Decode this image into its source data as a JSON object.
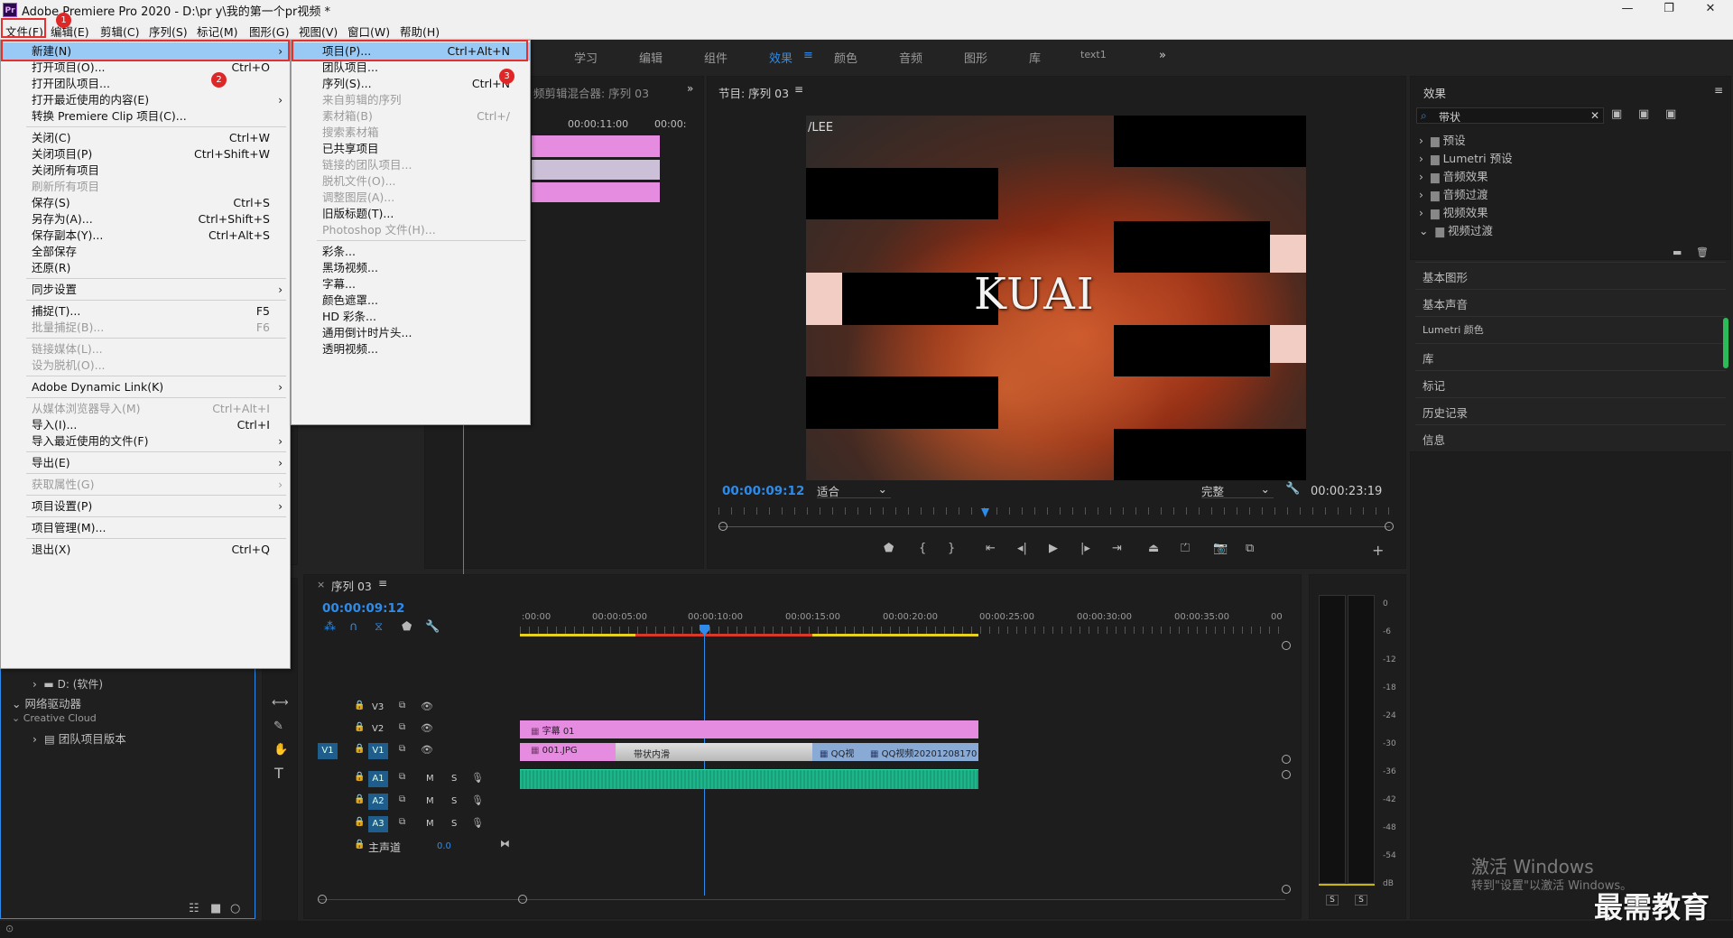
{
  "window": {
    "title": "Adobe Premiere Pro 2020 - D:\\pr y\\我的第一个pr视频 *",
    "app_icon": "Pr"
  },
  "menubar": [
    "文件(F)",
    "编辑(E)",
    "剪辑(C)",
    "序列(S)",
    "标记(M)",
    "图形(G)",
    "视图(V)",
    "窗口(W)",
    "帮助(H)"
  ],
  "workspaces": [
    {
      "label": "学习",
      "active": false
    },
    {
      "label": "编辑",
      "active": false
    },
    {
      "label": "组件",
      "active": false
    },
    {
      "label": "效果",
      "active": true
    },
    {
      "label": "颜色",
      "active": false
    },
    {
      "label": "音频",
      "active": false
    },
    {
      "label": "图形",
      "active": false
    },
    {
      "label": "库",
      "active": false
    },
    {
      "label": "text1",
      "active": false
    }
  ],
  "badges": [
    "1",
    "2",
    "3"
  ],
  "file_menu": [
    {
      "label": "新建(N)",
      "shortcut": "",
      "submenu": true,
      "disabled": false,
      "highlight": true
    },
    {
      "label": "打开项目(O)...",
      "shortcut": "Ctrl+O",
      "submenu": false,
      "disabled": false
    },
    {
      "label": "打开团队项目...",
      "shortcut": "",
      "submenu": false,
      "disabled": false
    },
    {
      "label": "打开最近使用的内容(E)",
      "shortcut": "",
      "submenu": true,
      "disabled": false
    },
    {
      "label": "转换 Premiere Clip 项目(C)...",
      "shortcut": "",
      "submenu": false,
      "disabled": false
    },
    {
      "sep": true
    },
    {
      "label": "关闭(C)",
      "shortcut": "Ctrl+W",
      "submenu": false,
      "disabled": false
    },
    {
      "label": "关闭项目(P)",
      "shortcut": "Ctrl+Shift+W",
      "submenu": false,
      "disabled": false
    },
    {
      "label": "关闭所有项目",
      "shortcut": "",
      "submenu": false,
      "disabled": false
    },
    {
      "label": "刷新所有项目",
      "shortcut": "",
      "submenu": false,
      "disabled": true
    },
    {
      "label": "保存(S)",
      "shortcut": "Ctrl+S",
      "submenu": false,
      "disabled": false
    },
    {
      "label": "另存为(A)...",
      "shortcut": "Ctrl+Shift+S",
      "submenu": false,
      "disabled": false
    },
    {
      "label": "保存副本(Y)...",
      "shortcut": "Ctrl+Alt+S",
      "submenu": false,
      "disabled": false
    },
    {
      "label": "全部保存",
      "shortcut": "",
      "submenu": false,
      "disabled": false
    },
    {
      "label": "还原(R)",
      "shortcut": "",
      "submenu": false,
      "disabled": false
    },
    {
      "sep": true
    },
    {
      "label": "同步设置",
      "shortcut": "",
      "submenu": true,
      "disabled": false
    },
    {
      "sep": true
    },
    {
      "label": "捕捉(T)...",
      "shortcut": "F5",
      "submenu": false,
      "disabled": false
    },
    {
      "label": "批量捕捉(B)...",
      "shortcut": "F6",
      "submenu": false,
      "disabled": true
    },
    {
      "sep": true
    },
    {
      "label": "链接媒体(L)...",
      "shortcut": "",
      "submenu": false,
      "disabled": true
    },
    {
      "label": "设为脱机(O)...",
      "shortcut": "",
      "submenu": false,
      "disabled": true
    },
    {
      "sep": true
    },
    {
      "label": "Adobe Dynamic Link(K)",
      "shortcut": "",
      "submenu": true,
      "disabled": false
    },
    {
      "sep": true
    },
    {
      "label": "从媒体浏览器导入(M)",
      "shortcut": "Ctrl+Alt+I",
      "submenu": false,
      "disabled": true
    },
    {
      "label": "导入(I)...",
      "shortcut": "Ctrl+I",
      "submenu": false,
      "disabled": false
    },
    {
      "label": "导入最近使用的文件(F)",
      "shortcut": "",
      "submenu": true,
      "disabled": false
    },
    {
      "sep": true
    },
    {
      "label": "导出(E)",
      "shortcut": "",
      "submenu": true,
      "disabled": false
    },
    {
      "sep": true
    },
    {
      "label": "获取属性(G)",
      "shortcut": "",
      "submenu": true,
      "disabled": true
    },
    {
      "sep": true
    },
    {
      "label": "项目设置(P)",
      "shortcut": "",
      "submenu": true,
      "disabled": false
    },
    {
      "sep": true
    },
    {
      "label": "项目管理(M)...",
      "shortcut": "",
      "submenu": false,
      "disabled": false
    },
    {
      "sep": true
    },
    {
      "label": "退出(X)",
      "shortcut": "Ctrl+Q",
      "submenu": false,
      "disabled": false
    }
  ],
  "new_submenu": [
    {
      "label": "项目(P)...",
      "shortcut": "Ctrl+Alt+N",
      "disabled": false,
      "highlight": true
    },
    {
      "label": "团队项目...",
      "shortcut": "",
      "disabled": false
    },
    {
      "label": "序列(S)...",
      "shortcut": "Ctrl+N",
      "disabled": false
    },
    {
      "label": "来自剪辑的序列",
      "shortcut": "",
      "disabled": true
    },
    {
      "label": "素材箱(B)",
      "shortcut": "Ctrl+/",
      "disabled": true
    },
    {
      "label": "搜索素材箱",
      "shortcut": "",
      "disabled": true
    },
    {
      "label": "已共享项目",
      "shortcut": "",
      "disabled": false
    },
    {
      "label": "链接的团队项目...",
      "shortcut": "",
      "disabled": true
    },
    {
      "label": "脱机文件(O)...",
      "shortcut": "",
      "disabled": true
    },
    {
      "label": "调整图层(A)...",
      "shortcut": "",
      "disabled": true
    },
    {
      "label": "旧版标题(T)...",
      "shortcut": "",
      "disabled": false
    },
    {
      "label": "Photoshop 文件(H)...",
      "shortcut": "",
      "disabled": true
    },
    {
      "sep": true
    },
    {
      "label": "彩条...",
      "shortcut": "",
      "disabled": false
    },
    {
      "label": "黑场视频...",
      "shortcut": "",
      "disabled": false
    },
    {
      "label": "字幕...",
      "shortcut": "",
      "disabled": false
    },
    {
      "label": "颜色遮罩...",
      "shortcut": "",
      "disabled": false
    },
    {
      "label": "HD 彩条...",
      "shortcut": "",
      "disabled": false
    },
    {
      "label": "通用倒计时片头...",
      "shortcut": "",
      "disabled": false
    },
    {
      "label": "透明视频...",
      "shortcut": "",
      "disabled": false
    }
  ],
  "source_panel": {
    "title": "频剪辑混合器: 序列 03",
    "times": [
      "00:00:11:00",
      "00:00:"
    ]
  },
  "program": {
    "title": "节目: 序列 03",
    "overlay_text": "KUAI",
    "corner_text": "/LEE",
    "timecode": "00:00:09:12",
    "fit": "适合",
    "quality": "完整",
    "duration": "00:00:23:19"
  },
  "effects": {
    "title": "效果",
    "search_value": "带状",
    "tree": [
      "预设",
      "Lumetri 预设",
      "音频效果",
      "音频过渡",
      "视频效果",
      "视频过渡"
    ],
    "panels": [
      "基本图形",
      "基本声音",
      "Lumetri 颜色",
      "库",
      "标记",
      "历史记录",
      "信息"
    ]
  },
  "timeline": {
    "tab": "序列 03",
    "timecode": "00:00:09:12",
    "ruler": [
      ":00:00",
      "00:00:05:00",
      "00:00:10:00",
      "00:00:15:00",
      "00:00:20:00",
      "00:00:25:00",
      "00:00:30:00",
      "00:00:35:00",
      "00"
    ],
    "video_tracks": [
      "V3",
      "V2",
      "V1"
    ],
    "audio_tracks": [
      "A1",
      "A2",
      "A3"
    ],
    "src_patch": "V1",
    "master": {
      "label": "主声道",
      "value": "0.0"
    },
    "clips": {
      "v2": "字幕 01",
      "v1a": "001.JPG",
      "transition": "带状内滑",
      "v1b": "QQ视",
      "v1c": "QQ视频20201208170"
    }
  },
  "project_tree": [
    "D: (软件)",
    "网络驱动器",
    "Creative Cloud",
    "团队项目版本"
  ],
  "meter_scale": [
    "0",
    "-6",
    "-12",
    "-18",
    "-24",
    "-30",
    "-36",
    "-42",
    "-48",
    "-54",
    "dB"
  ],
  "meter_solo": [
    "S",
    "S"
  ],
  "watermarks": {
    "activate_title": "激活 Windows",
    "activate_sub": "转到\"设置\"以激活 Windows。",
    "brand": "最需教育"
  }
}
